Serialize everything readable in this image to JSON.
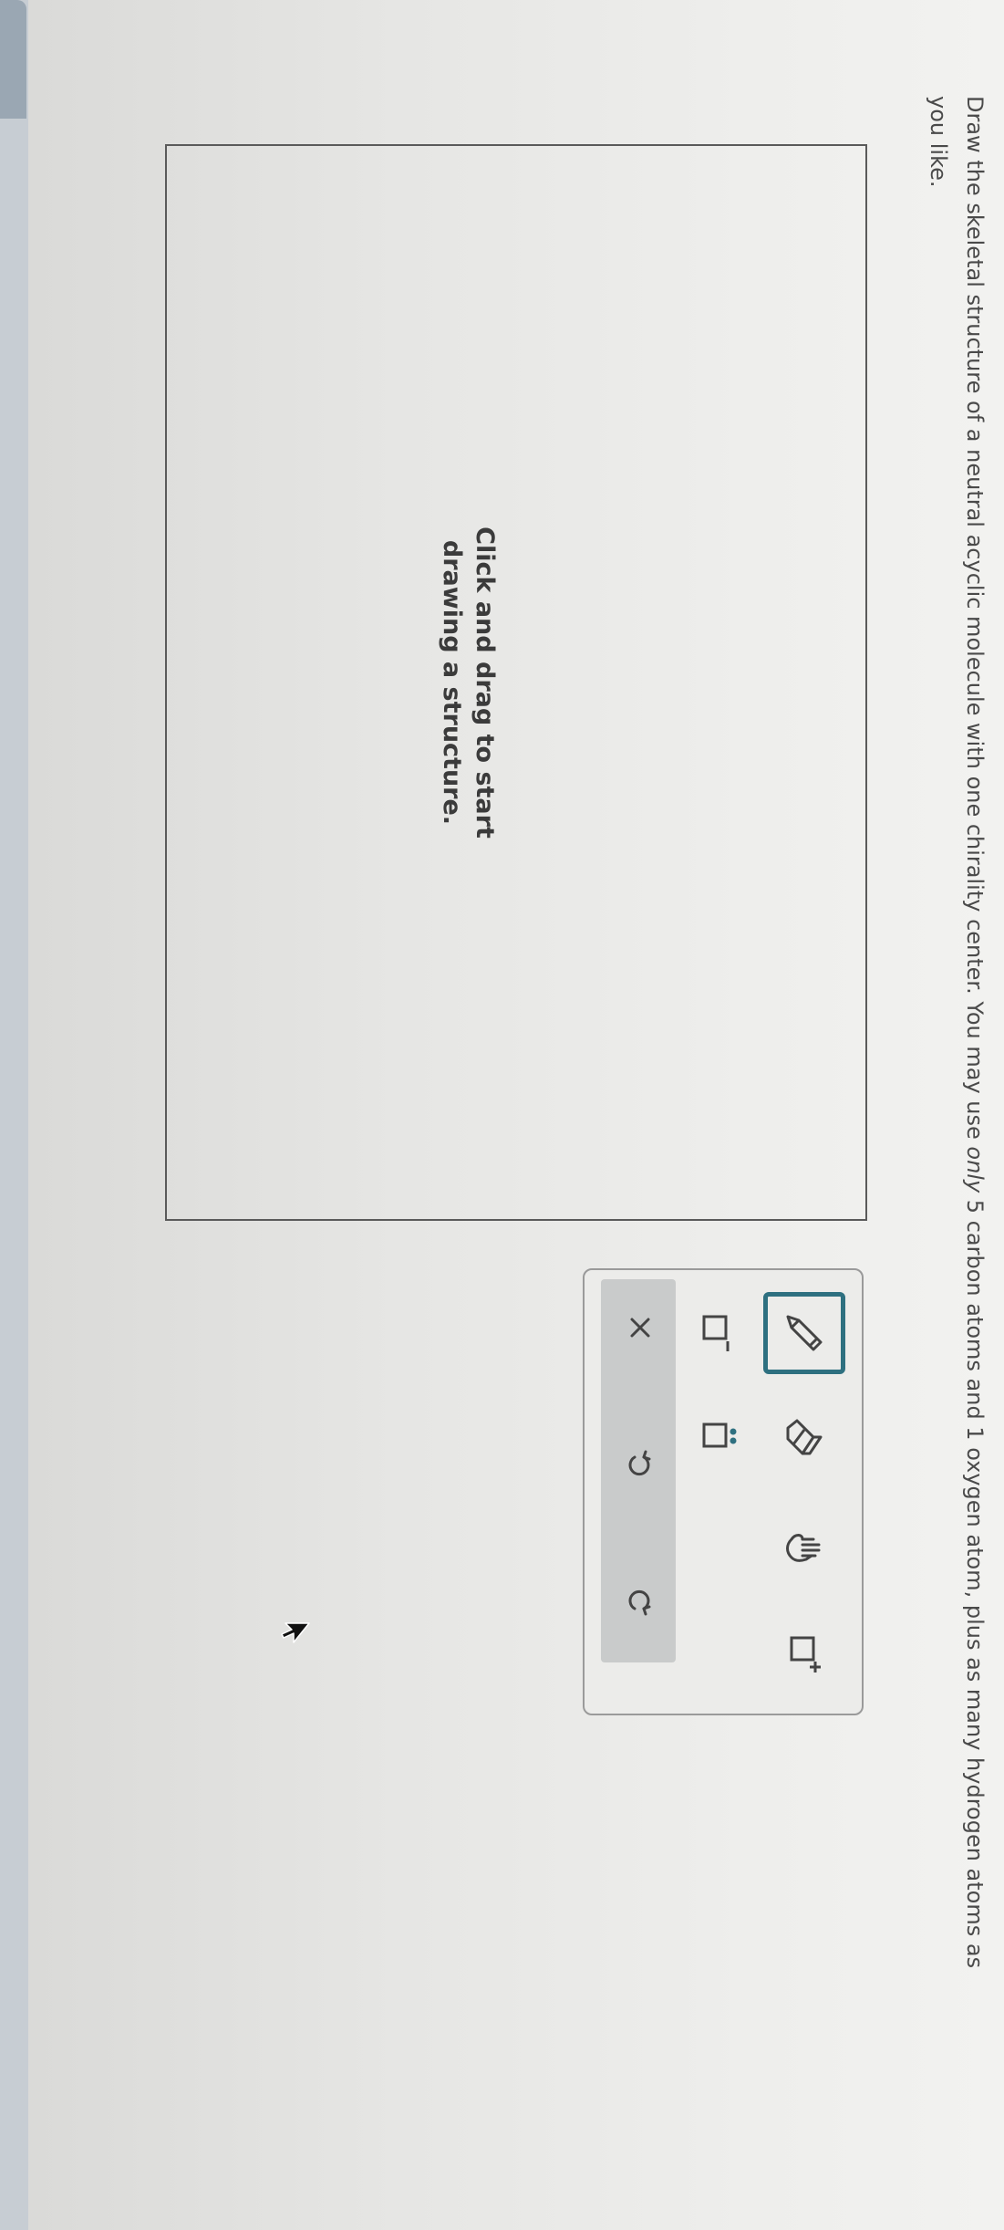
{
  "question": {
    "part1": "Draw the skeletal structure of a neutral acyclic molecule with one chirality center. You may use ",
    "emphasis": "only",
    "part2": " 5 carbon atoms and 1 oxygen atom, plus as many hydrogen atoms as you like."
  },
  "canvas": {
    "hint": "Click and drag to start drawing a structure."
  },
  "toolbar": {
    "tools": [
      {
        "icon": "pencil-icon",
        "label": "draw",
        "selected": true
      },
      {
        "icon": "eraser-icon",
        "label": "erase",
        "selected": false
      },
      {
        "icon": "hand-icon",
        "label": "move",
        "selected": false
      },
      {
        "icon": "positive-charge-icon",
        "label": "positive charge",
        "selected": false
      },
      {
        "icon": "negative-charge-icon",
        "label": "negative charge",
        "selected": false
      },
      {
        "icon": "lone-pair-icon",
        "label": "lone pair",
        "selected": false
      }
    ],
    "actions": [
      {
        "icon": "clear-x-icon"
      },
      {
        "icon": "undo-icon"
      },
      {
        "icon": "redo-icon"
      }
    ],
    "accent": "#2e7080"
  }
}
